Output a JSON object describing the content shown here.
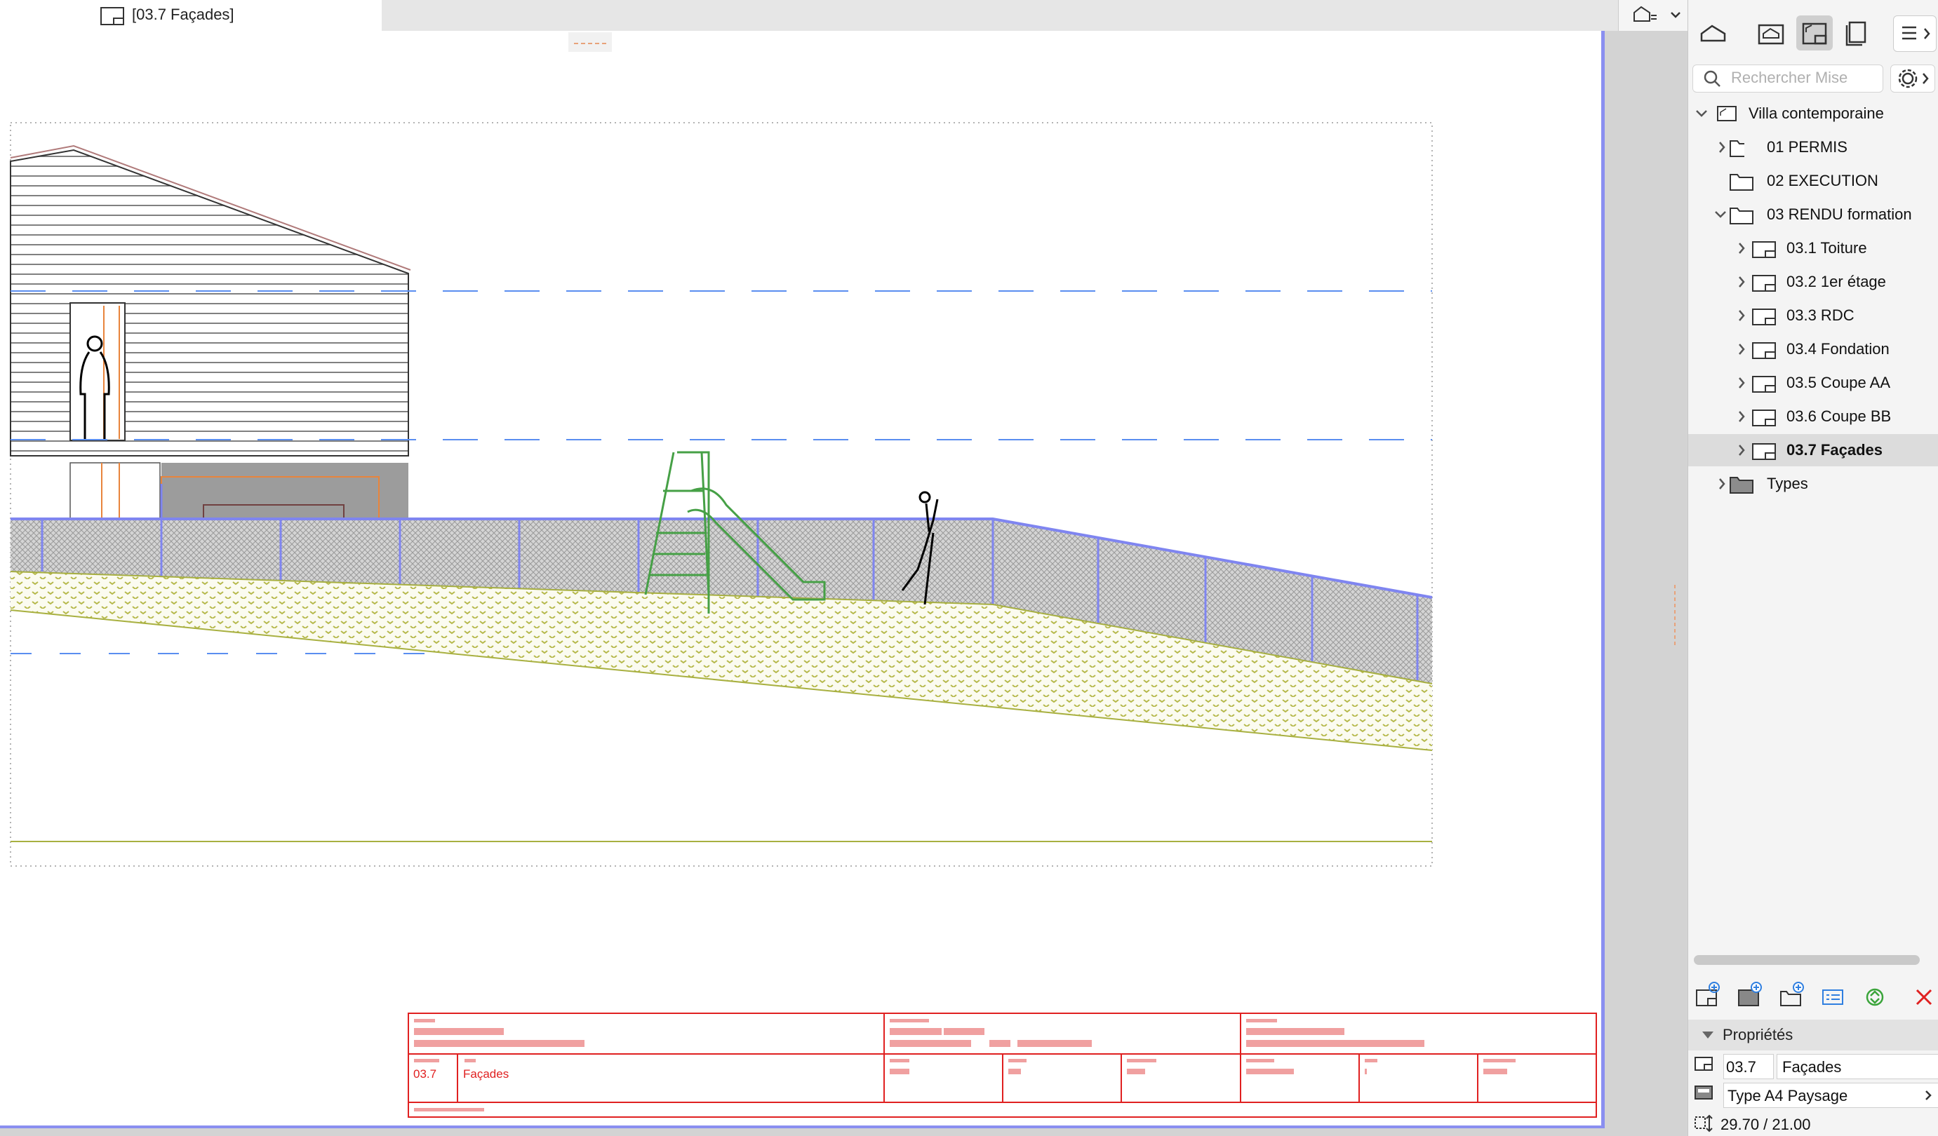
{
  "window": {
    "tab_title": "[03.7 Façades]"
  },
  "navigator": {
    "search_placeholder": "Rechercher Mise",
    "root": "Villa contemporaine",
    "items": [
      {
        "label": "01 PERMIS",
        "type": "folder",
        "expandable": true
      },
      {
        "label": "02 EXECUTION",
        "type": "folder",
        "expandable": false
      },
      {
        "label": "03 RENDU formation",
        "type": "folder",
        "expandable": true,
        "expanded": true
      },
      {
        "label": "03.1 Toiture",
        "type": "layout",
        "expandable": true
      },
      {
        "label": "03.2 1er étage",
        "type": "layout",
        "expandable": true
      },
      {
        "label": "03.3 RDC",
        "type": "layout",
        "expandable": true
      },
      {
        "label": "03.4 Fondation",
        "type": "layout",
        "expandable": true
      },
      {
        "label": "03.5 Coupe AA",
        "type": "layout",
        "expandable": true
      },
      {
        "label": "03.6 Coupe BB",
        "type": "layout",
        "expandable": true
      },
      {
        "label": "03.7 Façades",
        "type": "layout",
        "expandable": true,
        "selected": true
      },
      {
        "label": "Types",
        "type": "folder-dark",
        "expandable": true
      }
    ]
  },
  "properties": {
    "header": "Propriétés",
    "id_value": "03.7",
    "name_value": "Façades",
    "master": "Type A4 Paysage",
    "size": "29.70 / 21.00"
  },
  "title_block": {
    "number": "03.7",
    "name": "Façades"
  },
  "colors": {
    "selection": "#dcdcdc",
    "title_block": "#e02020",
    "fence_line": "#7f85f0",
    "ground": "#a8b040",
    "slide": "#46a046",
    "window_frame": "#e8843c",
    "story_line": "#5a8ef0",
    "delete_red": "#e02020",
    "refresh_green": "#3aa43a"
  }
}
